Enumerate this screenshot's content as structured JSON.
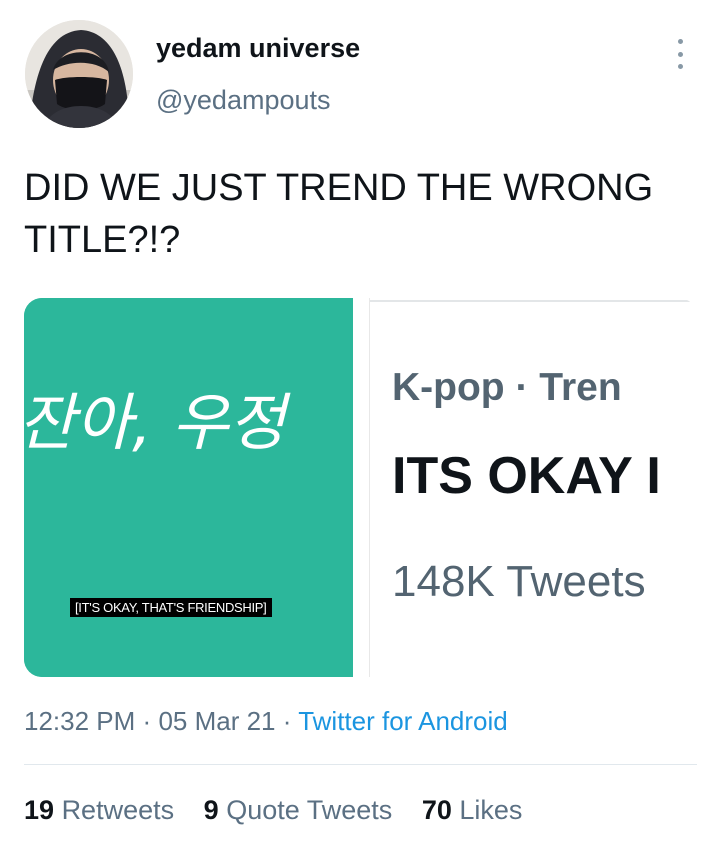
{
  "user": {
    "display_name": "yedam universe",
    "handle": "@yedampouts"
  },
  "tweet": {
    "text": "DID WE JUST TREND THE WRONG TITLE?!?"
  },
  "media": {
    "left": {
      "overlay_text": "잔아, 우정",
      "subtitle": "[IT'S OKAY, THAT'S FRIENDSHIP]",
      "color": "#2cb79b"
    },
    "right": {
      "category": "K-pop · Tren",
      "trend_name": "ITS OKAY I",
      "tweet_count": "148K Tweets"
    }
  },
  "meta": {
    "time": "12:32 PM",
    "sep1": "·",
    "date": "05 Mar 21",
    "sep2": "·",
    "source": "Twitter for Android"
  },
  "stats": {
    "retweets_count": "19",
    "retweets_label": "Retweets",
    "quotes_count": "9",
    "quotes_label": "Quote Tweets",
    "likes_count": "70",
    "likes_label": "Likes"
  },
  "colors": {
    "link": "#1b95e0",
    "secondary_text": "#5b7083",
    "media_teal": "#2cb79b"
  }
}
